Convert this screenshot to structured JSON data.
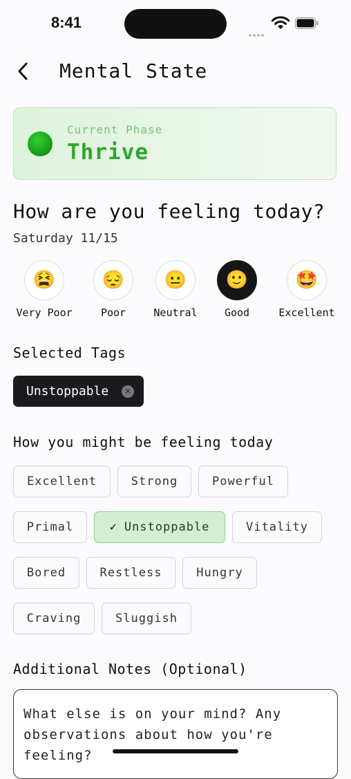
{
  "status": {
    "time": "8:41"
  },
  "nav": {
    "title": "Mental State",
    "back_icon": "chevron-left-icon"
  },
  "phase": {
    "label": "Current Phase",
    "value": "Thrive",
    "color": "#2fa62f"
  },
  "question": {
    "title": "How are you feeling today?",
    "date": "Saturday 11/15"
  },
  "moods": [
    {
      "label": "Very Poor",
      "emoji": "😫",
      "selected": false
    },
    {
      "label": "Poor",
      "emoji": "😔",
      "selected": false
    },
    {
      "label": "Neutral",
      "emoji": "😐",
      "selected": false
    },
    {
      "label": "Good",
      "emoji": "🙂",
      "selected": true
    },
    {
      "label": "Excellent",
      "emoji": "🤩",
      "selected": false
    }
  ],
  "selected_tags": {
    "title": "Selected Tags",
    "tags": [
      "Unstoppable"
    ]
  },
  "feelings": {
    "title": "How you might be feeling today",
    "chips": [
      {
        "label": "Excellent",
        "selected": false
      },
      {
        "label": "Strong",
        "selected": false
      },
      {
        "label": "Powerful",
        "selected": false
      },
      {
        "label": "Primal",
        "selected": false
      },
      {
        "label": "Unstoppable",
        "selected": true
      },
      {
        "label": "Vitality",
        "selected": false
      },
      {
        "label": "Bored",
        "selected": false
      },
      {
        "label": "Restless",
        "selected": false
      },
      {
        "label": "Hungry",
        "selected": false
      },
      {
        "label": "Craving",
        "selected": false
      },
      {
        "label": "Sluggish",
        "selected": false
      }
    ]
  },
  "notes": {
    "title": "Additional Notes (Optional)",
    "placeholder": "What else is on your mind? Any observations about how you're feeling?"
  }
}
